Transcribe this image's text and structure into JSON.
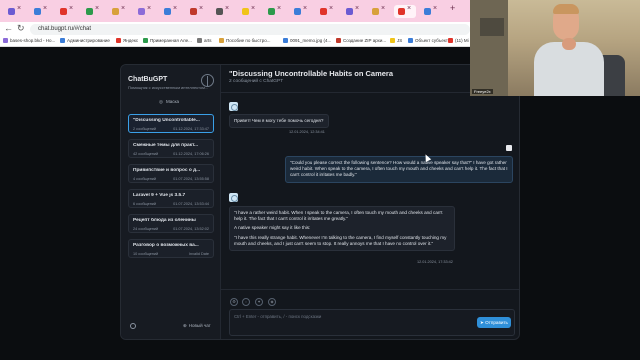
{
  "browser": {
    "url": "chat.bugpt.ru/#/chat",
    "bookmarks": [
      {
        "label": "bases-shop.bkd - Но...",
        "color": "#8c6bd8"
      },
      {
        "label": "Администрирование",
        "color": "#3b7dd8"
      },
      {
        "label": "Яндекс",
        "color": "#e0342a"
      },
      {
        "label": "Примеранная Але...",
        "color": "#2c9a4b"
      },
      {
        "label": "arts",
        "color": "#777777"
      },
      {
        "label": "Пособие по быстро...",
        "color": "#d8a13b"
      },
      {
        "label": "0091_memo.jpg (4...",
        "color": "#3b7dd8"
      },
      {
        "label": "Создание ZIP архи...",
        "color": "#c0392b"
      },
      {
        "label": "JS",
        "color": "#f0c419"
      },
      {
        "label": "Объект субъекте",
        "color": "#3b7dd8"
      },
      {
        "label": "(11) Мi",
        "color": "#e0342a"
      }
    ]
  },
  "sidebar": {
    "title": "ChatBuGPT",
    "subtitle": "Помощник с искусственным интеллектом...",
    "mask_label": "Маска",
    "chats": [
      {
        "title": "\"Discussing Uncontrollable...",
        "count": "2 сообщений",
        "date": "01.12.2024, 17:33:47"
      },
      {
        "title": "Смежные темы для практ...",
        "count": "42 сообщений",
        "date": "01.12.2024, 17:06:26"
      },
      {
        "title": "Привипствие и вопрос о д...",
        "count": "4 сообщений",
        "date": "01.07.2024, 13:55:58"
      },
      {
        "title": "Laravel 9 + Vue js 3.5.7",
        "count": "6 сообщений",
        "date": "01.07.2024, 13:53:44"
      },
      {
        "title": "Рецепт блюда из оленины",
        "count": "24 сообщений",
        "date": "01.07.2024, 13:52:02"
      },
      {
        "title": "Разговор о возможных ва...",
        "count": "10 сообщений",
        "date": "Invalid Date"
      }
    ],
    "new_chat_label": "Новый чат"
  },
  "main": {
    "title": "\"Discussing Uncontrollable Habits on Camera",
    "subtitle": "2 сообщений с ChatGPT",
    "messages": [
      {
        "role": "bot",
        "paragraphs": [
          "Привет! Чем я могу тебе помочь сегодня?"
        ],
        "timestamp": "12.01.2024, 12:34:41"
      },
      {
        "role": "user",
        "paragraphs": [
          "\"Could you please correct the following sentence? How would a native speaker say that?\" I have got rather weird habit. When speak to the camera, I often touch my mouth and cheeks and can't help it. The fact that I can't control it irritates me badly.\""
        ],
        "timestamp": ""
      },
      {
        "role": "bot",
        "paragraphs": [
          "\"I have a rather weird habit. When I speak to the camera, I often touch my mouth and cheeks and can't help it. The fact that I can't control it irritates me greatly.\"",
          "A native speaker might say it like this:",
          "\"I have this really strange habit. Whenever I'm talking to the camera, I find myself constantly touching my mouth and cheeks, and I just can't seem to stop. It really annoys me that I have no control over it.\""
        ],
        "timestamp": "12.01.2024, 17:33:42"
      }
    ],
    "input_placeholder": "Ctrl + Enter - отправить, / - поиск подсказки",
    "send_label": "Отправить"
  },
  "webcam": {
    "label": "Freeye2x"
  },
  "colors": {
    "accent": "#2f8fd8",
    "tabstrip": "#f9cfe3",
    "panel": "#13171d"
  }
}
